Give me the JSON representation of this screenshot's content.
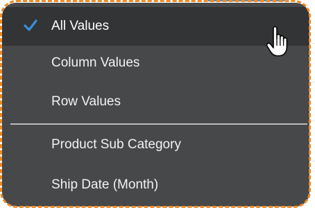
{
  "menu": {
    "items": [
      {
        "label": "All Values",
        "checked": true
      },
      {
        "label": "Column Values",
        "checked": false
      },
      {
        "label": "Row Values",
        "checked": false
      },
      {
        "label": "Product Sub Category",
        "checked": false
      },
      {
        "label": "Ship Date (Month)",
        "checked": false
      }
    ]
  },
  "icons": {
    "check": "checkmark-icon",
    "cursor": "hand-pointer-cursor-icon"
  },
  "colors": {
    "menu_bg": "#474849",
    "selected_bg": "#333435",
    "text": "#f2f2f2",
    "check": "#3a8fe0",
    "highlight_outline": "#f08a24",
    "separator": "#bdbdbd"
  }
}
